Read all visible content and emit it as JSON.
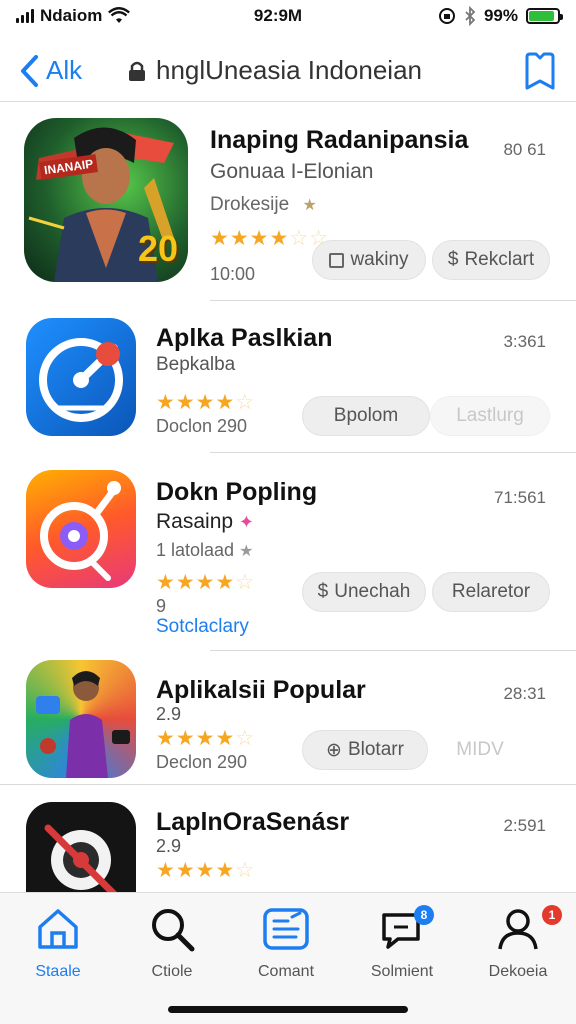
{
  "status": {
    "carrier": "Ndaiom",
    "time": "92:9M",
    "battery": "99%",
    "battery_level": 0.9
  },
  "nav": {
    "back_label": "Alk",
    "title": "hnglUneasia Indoneian"
  },
  "apps": [
    {
      "title": "Inaping Radanipansia",
      "subtitle": "Gonuaa I-Elonian",
      "category": "Drokesije",
      "size": "80 61",
      "rating_text": "10:00",
      "stars": 3.5,
      "btn1": "wakiny",
      "btn2": "Rekclart",
      "badge": "20"
    },
    {
      "title": "Aplka Paslkian",
      "subtitle": "Bepkalba",
      "size": "3:361",
      "stars": 4.5,
      "rating_text": "Doclon 290",
      "btn1": "Bpolom",
      "btn2": "Lastlurg"
    },
    {
      "title": "Dokn Popling",
      "subtitle": "Rasainp",
      "meta": "1 latolaad",
      "size": "71:561",
      "stars": 4.5,
      "rating_text": "9",
      "link": "Sotclaclary",
      "btn1": "Unechah",
      "btn2": "Relaretor"
    },
    {
      "title": "Aplikalsii Popular",
      "subtitle": "2.9",
      "size": "28:31",
      "stars": 4.5,
      "rating_text": "Declon 290",
      "btn1": "Blotarr",
      "btn2": "MIDV"
    },
    {
      "title": "LaplnOraSenásr",
      "subtitle": "2.9",
      "size": "2:591",
      "stars": 4.5
    }
  ],
  "tabs": [
    {
      "label": "Staale",
      "icon": "home-icon",
      "active": true
    },
    {
      "label": "Ctiole",
      "icon": "search-icon"
    },
    {
      "label": "Comant",
      "icon": "notes-icon"
    },
    {
      "label": "Solmient",
      "icon": "chat-icon",
      "badge": "8"
    },
    {
      "label": "Dekoeia",
      "icon": "profile-icon",
      "badge": "1"
    }
  ],
  "colors": {
    "accent": "#1c7ef0",
    "star": "#f5a623",
    "battery": "#2fbf3a"
  }
}
